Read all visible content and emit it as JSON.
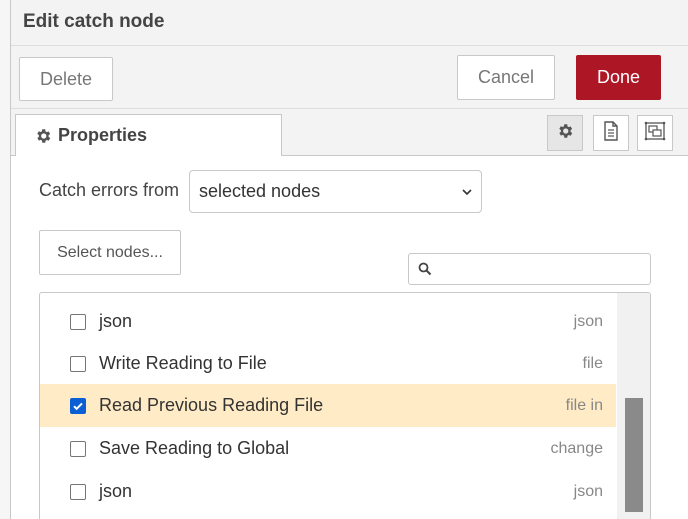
{
  "header": {
    "title": "Edit catch node"
  },
  "toolbar": {
    "delete_label": "Delete",
    "cancel_label": "Cancel",
    "done_label": "Done",
    "done_color": "#ad1625"
  },
  "tabs": [
    {
      "label": "Properties",
      "icon": "gear-icon"
    }
  ],
  "tab_icons": [
    "settings-gear-icon",
    "description-document-icon",
    "appearance-frame-icon"
  ],
  "form": {
    "catch_label": "Catch errors from",
    "scope_select": {
      "value": "selected nodes"
    },
    "select_nodes_label": "Select nodes...",
    "search": {
      "placeholder": "",
      "value": ""
    }
  },
  "node_list": [
    {
      "label": "json",
      "type": "json",
      "checked": false,
      "highlighted": false
    },
    {
      "label": "Write Reading to File",
      "type": "file",
      "checked": false,
      "highlighted": false
    },
    {
      "label": "Read Previous Reading File",
      "type": "file in",
      "checked": true,
      "highlighted": true
    },
    {
      "label": "Save Reading to Global",
      "type": "change",
      "checked": false,
      "highlighted": false
    },
    {
      "label": "json",
      "type": "json",
      "checked": false,
      "highlighted": false
    }
  ],
  "colors": {
    "highlight": "#ffebc6",
    "checkbox_checked": "#0b5fd5"
  }
}
